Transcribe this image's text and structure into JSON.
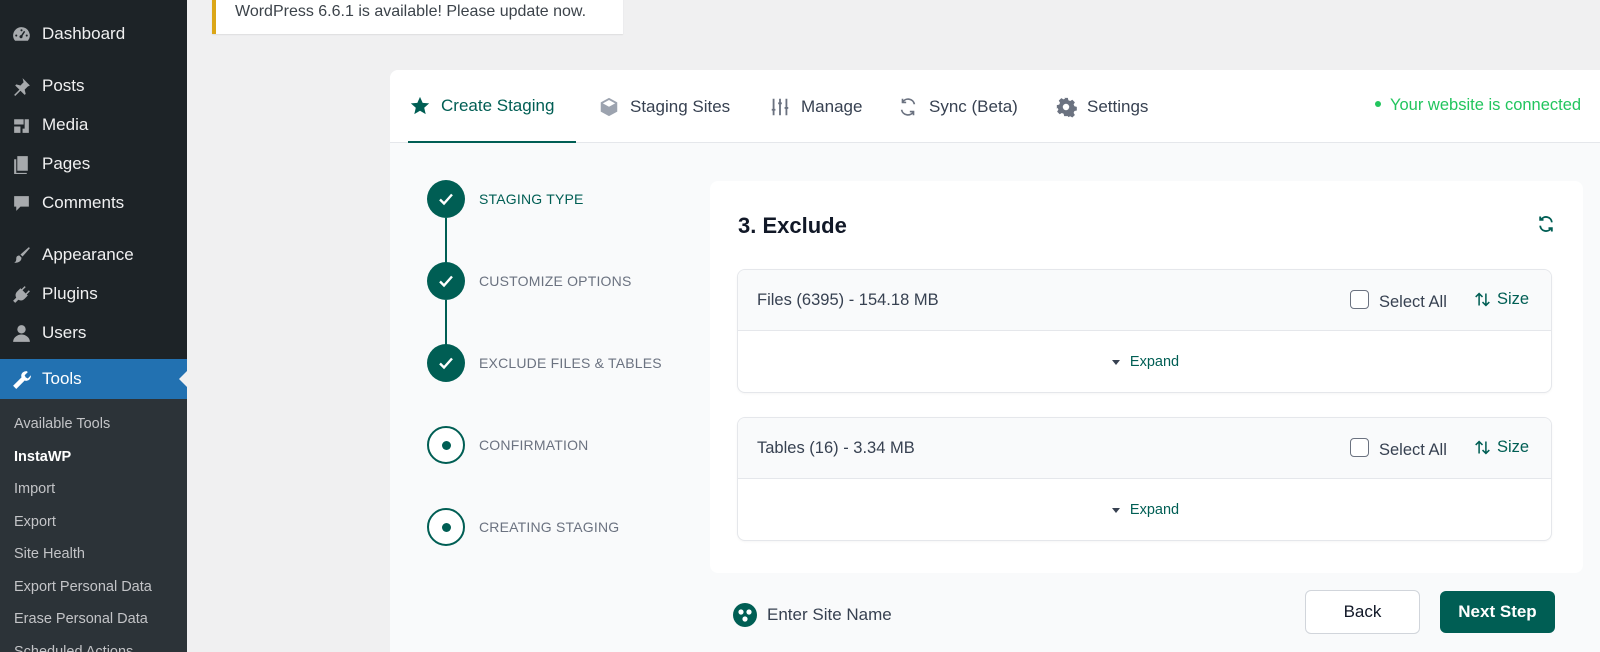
{
  "sidebar": {
    "items": [
      {
        "label": "Dashboard",
        "icon": "dashboard-icon"
      },
      {
        "label": "Posts",
        "icon": "pin-icon"
      },
      {
        "label": "Media",
        "icon": "media-icon"
      },
      {
        "label": "Pages",
        "icon": "pages-icon"
      },
      {
        "label": "Comments",
        "icon": "comment-icon"
      },
      {
        "label": "Appearance",
        "icon": "paintbrush-icon"
      },
      {
        "label": "Plugins",
        "icon": "plugin-icon"
      },
      {
        "label": "Users",
        "icon": "user-icon"
      },
      {
        "label": "Tools",
        "icon": "wrench-icon",
        "active": true
      }
    ],
    "submenu": [
      {
        "label": "Available Tools"
      },
      {
        "label": "InstaWP",
        "current": true
      },
      {
        "label": "Import"
      },
      {
        "label": "Export"
      },
      {
        "label": "Site Health"
      },
      {
        "label": "Export Personal Data"
      },
      {
        "label": "Erase Personal Data"
      },
      {
        "label": "Scheduled Actions"
      }
    ]
  },
  "notice": {
    "text": "WordPress 6.6.1 is available! Please update now."
  },
  "tabs": [
    {
      "label": "Create Staging",
      "icon": "star-icon",
      "active": true
    },
    {
      "label": "Staging Sites",
      "icon": "cube-icon"
    },
    {
      "label": "Manage",
      "icon": "sliders-icon"
    },
    {
      "label": "Sync (Beta)",
      "icon": "sync-icon"
    },
    {
      "label": "Settings",
      "icon": "gear-icon"
    }
  ],
  "status": {
    "text": "Your website is connected"
  },
  "steps": [
    {
      "label": "STAGING TYPE",
      "state": "done"
    },
    {
      "label": "CUSTOMIZE OPTIONS",
      "state": "done"
    },
    {
      "label": "EXCLUDE FILES & TABLES",
      "state": "done"
    },
    {
      "label": "CONFIRMATION",
      "state": "pending"
    },
    {
      "label": "CREATING STAGING",
      "state": "pending"
    }
  ],
  "card": {
    "title": "3. Exclude",
    "sections": [
      {
        "title": "Files (6395) - 154.18 MB",
        "select_all": "Select All",
        "sort": "Size",
        "expand": "Expand"
      },
      {
        "title": "Tables (16) - 3.34 MB",
        "select_all": "Select All",
        "sort": "Size",
        "expand": "Expand"
      }
    ]
  },
  "footer": {
    "site_name_placeholder": "Enter Site Name",
    "back_label": "Back",
    "next_label": "Next Step"
  },
  "colors": {
    "accent": "#005e54",
    "sidebar_bg": "#1d2327",
    "active_menu": "#2271b1",
    "connected": "#22c55e",
    "notice_border": "#dba617"
  }
}
